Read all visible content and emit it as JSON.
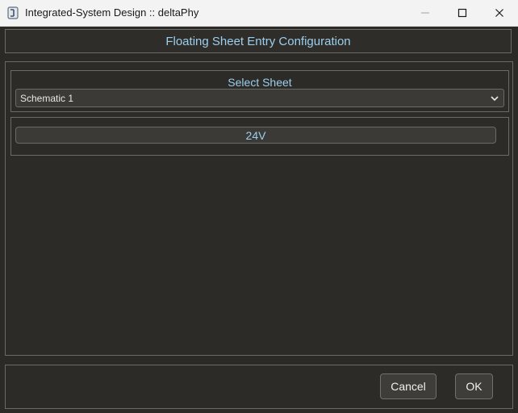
{
  "window": {
    "title": "Integrated-System Design :: deltaPhy"
  },
  "dialog": {
    "header_title": "Floating Sheet Entry Configuration",
    "select_sheet": {
      "label": "Select Sheet",
      "selected": "Schematic 1"
    },
    "entries": [
      {
        "label": "24V"
      }
    ],
    "buttons": {
      "cancel": "Cancel",
      "ok": "OK"
    }
  },
  "colors": {
    "accent_text": "#9ccfee",
    "background": "#2b2a26",
    "titlebar": "#f3f3f3"
  },
  "icons": {
    "app": "app-icon",
    "minimize": "minimize-icon",
    "maximize": "maximize-icon",
    "close": "close-icon",
    "dropdown": "chevron-down-icon"
  }
}
